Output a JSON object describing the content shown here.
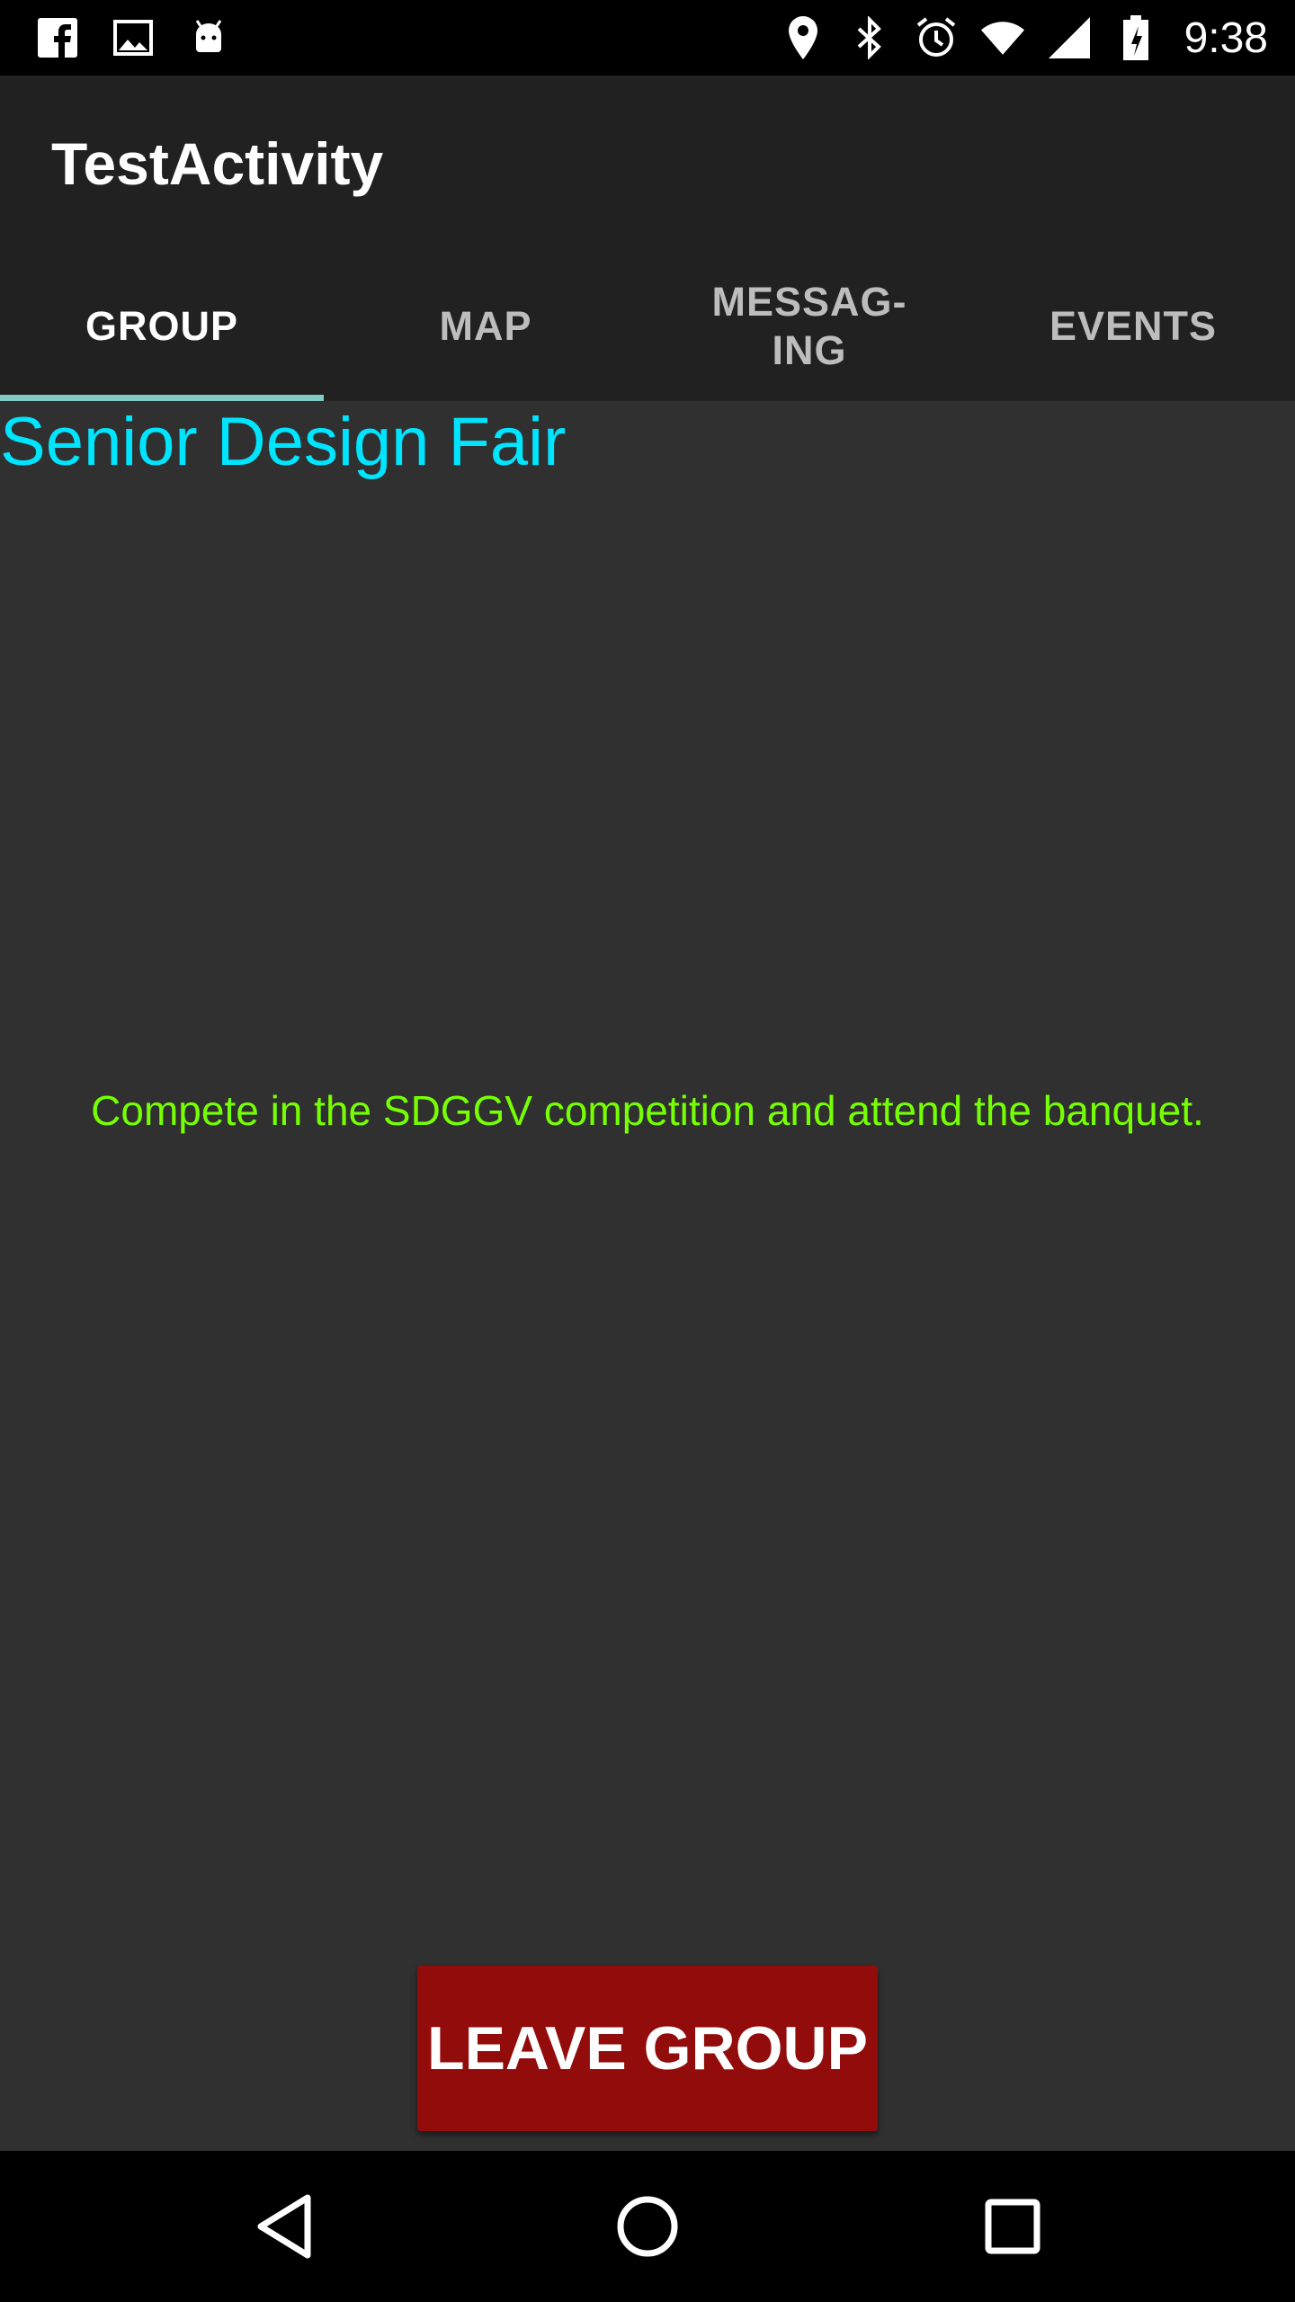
{
  "status_bar": {
    "time": "9:38",
    "left_icons": [
      "facebook-icon",
      "image-icon",
      "android-icon"
    ],
    "right_icons": [
      "location-icon",
      "bluetooth-icon",
      "alarm-icon",
      "wifi-icon",
      "signal-icon",
      "battery-icon"
    ]
  },
  "app_bar": {
    "title": "TestActivity"
  },
  "tabs": [
    {
      "label": "GROUP",
      "active": true
    },
    {
      "label": "MAP",
      "active": false
    },
    {
      "label": "MESSAG-\nING",
      "active": false
    },
    {
      "label": "EVENTS",
      "active": false
    }
  ],
  "group": {
    "title": "Senior Design Fair",
    "description": "Compete in the SDGGV competition and attend the banquet.",
    "leave_button": "LEAVE GROUP"
  },
  "nav_bar": {
    "buttons": [
      "back-icon",
      "home-icon",
      "recents-icon"
    ]
  },
  "colors": {
    "title": "#00e5ff",
    "description": "#76ff03",
    "leave_button": "#930c0c",
    "tab_indicator": "#80cbc4"
  }
}
